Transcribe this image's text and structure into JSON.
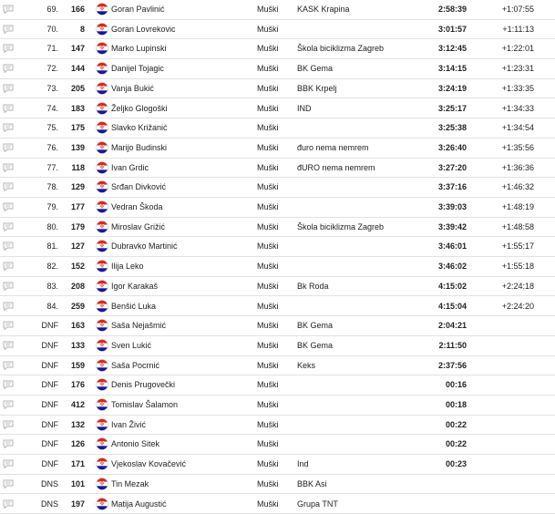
{
  "icons": {
    "row_icon": "comment-icon",
    "flag_icon": "croatia-flag-icon"
  },
  "colors": {
    "row_divider": "#e2e2e2",
    "text": "#222222",
    "icon": "#b5b5b5",
    "flag_red": "#d52b1e",
    "flag_blue": "#171796"
  },
  "rows": [
    {
      "pos": "69.",
      "bib": "166",
      "name": "Goran Pavlinić",
      "category": "Muški",
      "club": "KASK Krapina",
      "time": "2:58:39",
      "gap": "+1:07:55"
    },
    {
      "pos": "70.",
      "bib": "8",
      "name": "Goran Lovrekovic",
      "category": "Muški",
      "club": "",
      "time": "3:01:57",
      "gap": "+1:11:13"
    },
    {
      "pos": "71.",
      "bib": "147",
      "name": "Marko Lupinski",
      "category": "Muški",
      "club": "Škola biciklizma Zagreb",
      "time": "3:12:45",
      "gap": "+1:22:01"
    },
    {
      "pos": "72.",
      "bib": "144",
      "name": "Danijel Tojagic",
      "category": "Muški",
      "club": "BK Gema",
      "time": "3:14:15",
      "gap": "+1:23:31"
    },
    {
      "pos": "73.",
      "bib": "205",
      "name": "Vanja Bukić",
      "category": "Muški",
      "club": "BBK Krpelj",
      "time": "3:24:19",
      "gap": "+1:33:35"
    },
    {
      "pos": "74.",
      "bib": "183",
      "name": "Željko Glogoški",
      "category": "Muški",
      "club": "IND",
      "time": "3:25:17",
      "gap": "+1:34:33"
    },
    {
      "pos": "75.",
      "bib": "175",
      "name": "Slavko Križanić",
      "category": "Muški",
      "club": "",
      "time": "3:25:38",
      "gap": "+1:34:54"
    },
    {
      "pos": "76.",
      "bib": "139",
      "name": "Marijo Budinski",
      "category": "Muški",
      "club": "đuro nema nemrem",
      "time": "3:26:40",
      "gap": "+1:35:56"
    },
    {
      "pos": "77.",
      "bib": "118",
      "name": "Ivan Grdic",
      "category": "Muški",
      "club": "đURO nema nemrem",
      "time": "3:27:20",
      "gap": "+1:36:36"
    },
    {
      "pos": "78.",
      "bib": "129",
      "name": "Srđan Divković",
      "category": "Muški",
      "club": "",
      "time": "3:37:16",
      "gap": "+1:46:32"
    },
    {
      "pos": "79.",
      "bib": "177",
      "name": "Vedran Škoda",
      "category": "Muški",
      "club": "",
      "time": "3:39:03",
      "gap": "+1:48:19"
    },
    {
      "pos": "80.",
      "bib": "179",
      "name": "Miroslav Grižić",
      "category": "Muški",
      "club": "Škola biciklizma Zagreb",
      "time": "3:39:42",
      "gap": "+1:48:58"
    },
    {
      "pos": "81.",
      "bib": "127",
      "name": "Dubravko Martinić",
      "category": "Muški",
      "club": "",
      "time": "3:46:01",
      "gap": "+1:55:17"
    },
    {
      "pos": "82.",
      "bib": "152",
      "name": "Ilija Leko",
      "category": "Muški",
      "club": "",
      "time": "3:46:02",
      "gap": "+1:55:18"
    },
    {
      "pos": "83.",
      "bib": "208",
      "name": "Igor Karakaš",
      "category": "Muški",
      "club": "Bk Roda",
      "time": "4:15:02",
      "gap": "+2:24:18"
    },
    {
      "pos": "84.",
      "bib": "259",
      "name": "Benšić Luka",
      "category": "Muški",
      "club": "",
      "time": "4:15:04",
      "gap": "+2:24:20"
    },
    {
      "pos": "DNF",
      "bib": "163",
      "name": "Saša Nejašmić",
      "category": "Muški",
      "club": "BK Gema",
      "time": "2:04:21",
      "gap": ""
    },
    {
      "pos": "DNF",
      "bib": "133",
      "name": "Sven Lukić",
      "category": "Muški",
      "club": "BK Gema",
      "time": "2:11:50",
      "gap": ""
    },
    {
      "pos": "DNF",
      "bib": "159",
      "name": "Saša Pocrnić",
      "category": "Muški",
      "club": "Keks",
      "time": "2:37:56",
      "gap": ""
    },
    {
      "pos": "DNF",
      "bib": "176",
      "name": "Denis Prugovečki",
      "category": "Muški",
      "club": "",
      "time": "00:16",
      "gap": ""
    },
    {
      "pos": "DNF",
      "bib": "412",
      "name": "Tomislav Šalamon",
      "category": "Muški",
      "club": "",
      "time": "00:18",
      "gap": ""
    },
    {
      "pos": "DNF",
      "bib": "132",
      "name": "Ivan Živić",
      "category": "Muški",
      "club": "",
      "time": "00:22",
      "gap": ""
    },
    {
      "pos": "DNF",
      "bib": "126",
      "name": "Antonio Sitek",
      "category": "Muški",
      "club": "",
      "time": "00:22",
      "gap": ""
    },
    {
      "pos": "DNF",
      "bib": "171",
      "name": "Vjekoslav Kovačević",
      "category": "Muški",
      "club": "Ind",
      "time": "00:23",
      "gap": ""
    },
    {
      "pos": "DNS",
      "bib": "101",
      "name": "Tin Mezak",
      "category": "Muški",
      "club": "BBK Asi",
      "time": "",
      "gap": ""
    },
    {
      "pos": "DNS",
      "bib": "197",
      "name": "Matija Augustić",
      "category": "Muški",
      "club": "Grupa TNT",
      "time": "",
      "gap": ""
    }
  ]
}
